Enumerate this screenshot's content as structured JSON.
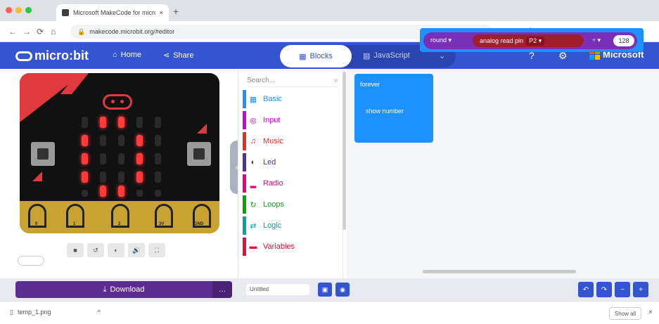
{
  "browser": {
    "tab_title": "Microsoft MakeCode for micro:bit",
    "url": "makecode.microbit.org/#editor",
    "new_tab": "+",
    "nav": {
      "back": "←",
      "forward": "→",
      "reload": "⟳",
      "home": "⌂"
    }
  },
  "header": {
    "logo": "micro:bit",
    "home_label": "Home",
    "share_label": "Share",
    "blocks_label": "Blocks",
    "javascript_label": "JavaScript",
    "brand": "Microsoft"
  },
  "toolbox": {
    "search_placeholder": "Search...",
    "categories": [
      {
        "label": "Basic",
        "color": "#1e90ff",
        "icon": "▦"
      },
      {
        "label": "Input",
        "color": "#d400d4",
        "icon": "◎"
      },
      {
        "label": "Music",
        "color": "#e63022",
        "icon": "♫"
      },
      {
        "label": "Led",
        "color": "#5c2d91",
        "icon": "◐"
      },
      {
        "label": "Radio",
        "color": "#e3008c",
        "icon": "▂"
      },
      {
        "label": "Loops",
        "color": "#00aa00",
        "icon": "↻"
      },
      {
        "label": "Logic",
        "color": "#00a4a6",
        "icon": "⇄"
      },
      {
        "label": "Variables",
        "color": "#dc143c",
        "icon": "▬"
      }
    ]
  },
  "workspace": {
    "forever_label": "forever",
    "show_number_label": "show number",
    "round_label": "round ▾",
    "analog_label": "analog read pin",
    "pin_value": "P2 ▾",
    "operator": "÷ ▾",
    "number": "128"
  },
  "simulator": {
    "pin_labels": [
      "0",
      "1",
      "2",
      "3V",
      "GND"
    ],
    "controls": [
      "■",
      "↺",
      "◐",
      "🔊",
      "⛶"
    ]
  },
  "bottom": {
    "download_label": "Download",
    "download_more": "…",
    "project_name": "Untitled",
    "undo": "↶",
    "redo": "↷",
    "zoom_out": "−",
    "zoom_in": "+"
  },
  "downloads_bar": {
    "file": "temp_1.png",
    "caret": "^",
    "show_all": "Show all",
    "close": "×"
  }
}
